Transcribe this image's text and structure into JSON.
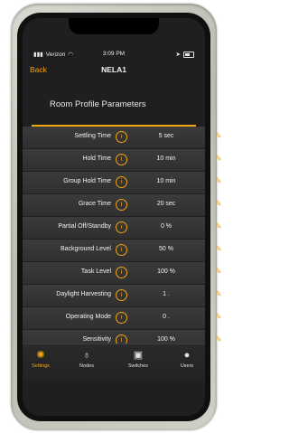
{
  "status": {
    "carrier": "Verizon",
    "time": "3:09 PM"
  },
  "nav": {
    "back_label": "Back",
    "title": "NELA1"
  },
  "section": {
    "title": "Room Profile Parameters"
  },
  "params": [
    {
      "label": "Settling Time",
      "value": "5 sec"
    },
    {
      "label": "Hold Time",
      "value": "10 min"
    },
    {
      "label": "Group Hold Time",
      "value": "10 min"
    },
    {
      "label": "Grace Time",
      "value": "20 sec"
    },
    {
      "label": "Partial Off/Standby",
      "value": "0 %"
    },
    {
      "label": "Background Level",
      "value": "50 %"
    },
    {
      "label": "Task Level",
      "value": "100 %"
    },
    {
      "label": "Daylight Harvesting",
      "value": "1 ."
    },
    {
      "label": "Operating Mode",
      "value": "0 ."
    },
    {
      "label": "Sensitivity",
      "value": "100 %"
    }
  ],
  "tabs": [
    {
      "label": "Settings",
      "icon": "gear-icon",
      "active": true
    },
    {
      "label": "Nodes",
      "icon": "bulb-icon"
    },
    {
      "label": "Switches",
      "icon": "switch-icon"
    },
    {
      "label": "Users",
      "icon": "user-icon"
    }
  ],
  "colors": {
    "accent": "#f2a514",
    "background": "#1f1f1f",
    "row": "#363636"
  }
}
